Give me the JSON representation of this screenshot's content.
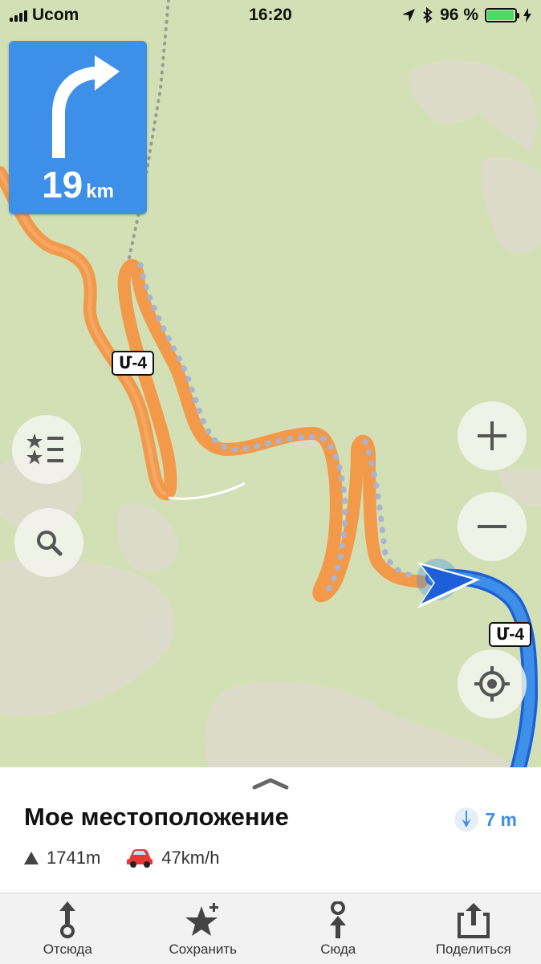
{
  "status_bar": {
    "carrier": "Ucom",
    "time": "16:20",
    "battery_percent": "96 %",
    "battery_level": 0.96
  },
  "navigation": {
    "turn_distance_value": "19",
    "turn_distance_unit": "km",
    "turn_icon": "turn-right-arrow-icon"
  },
  "map": {
    "road_shield_1": "Մ-4",
    "road_shield_2": "Մ-4"
  },
  "map_controls": {
    "bookmarks_icon": "bookmarks-list-icon",
    "search_icon": "search-icon",
    "zoom_in_icon": "plus-icon",
    "zoom_out_icon": "minus-icon",
    "locate_icon": "my-location-icon"
  },
  "place": {
    "title": "Мое местоположение",
    "distance": "7 m",
    "altitude": "1741m",
    "speed": "47km/h"
  },
  "tabs": [
    {
      "label": "Отсюда",
      "icon": "route-from-icon"
    },
    {
      "label": "Сохранить",
      "icon": "add-bookmark-icon"
    },
    {
      "label": "Сюда",
      "icon": "route-to-icon"
    },
    {
      "label": "Поделиться",
      "icon": "share-icon"
    }
  ],
  "colors": {
    "accent": "#3d8fe8",
    "route_orange": "#f2994a",
    "map_green": "#d3e0b5",
    "map_rock": "#dcdac8"
  }
}
